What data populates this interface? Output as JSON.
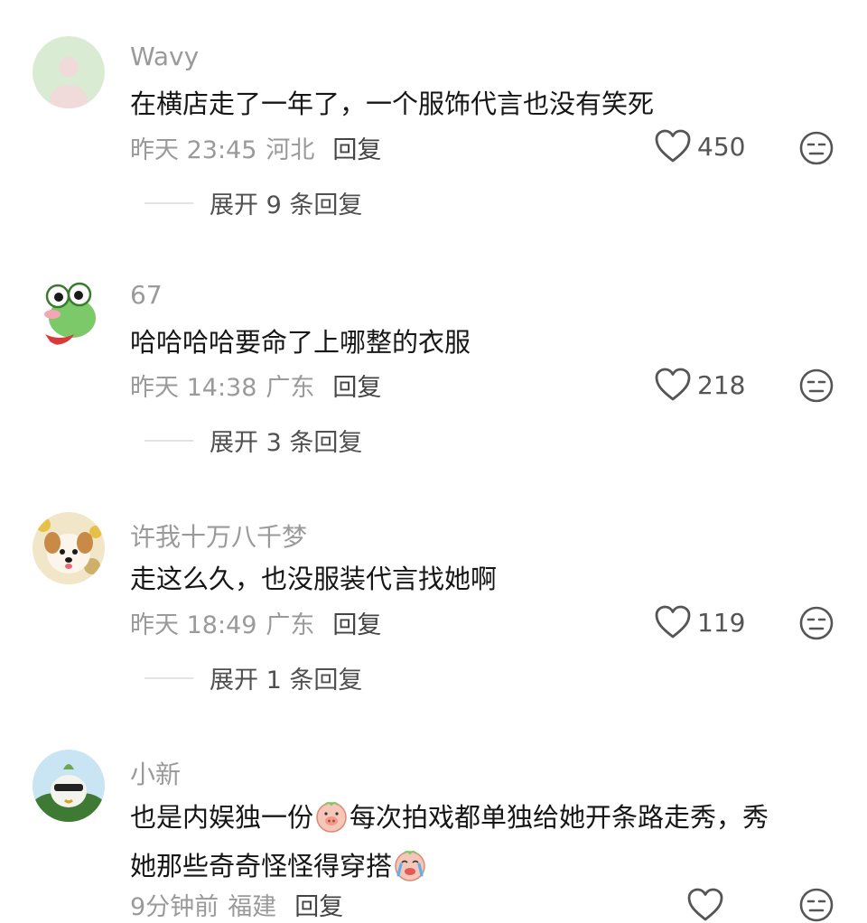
{
  "comments": [
    {
      "username": "Wavy",
      "lines": [
        "在横店走了一年了，一个服饰代言也没有笑死"
      ],
      "time": "昨天 23:45",
      "location": "河北",
      "reply_label": "回复",
      "likes": "450",
      "expand": "展开 9 条回复"
    },
    {
      "username": "67",
      "lines": [
        "哈哈哈哈要命了上哪整的衣服"
      ],
      "time": "昨天 14:38",
      "location": "广东",
      "reply_label": "回复",
      "likes": "218",
      "expand": "展开 3 条回复"
    },
    {
      "username": "许我十万八千梦",
      "lines": [
        "走这么久，也没服装代言找她啊"
      ],
      "time": "昨天 18:49",
      "location": "广东",
      "reply_label": "回复",
      "likes": "119",
      "expand": "展开 1 条回复"
    },
    {
      "username": "小新",
      "line1_a": "也是内娱独一份",
      "line1_b": "每次拍戏都单独给她开条路走秀，秀",
      "line2": "她那些奇奇怪怪得穿搭",
      "time": "9分钟前",
      "location": "福建",
      "reply_label": "回复",
      "emojis": [
        "pig-emoji",
        "crying-pig-emoji"
      ]
    }
  ],
  "icons": {
    "like": "heart-outline-icon",
    "dislike": "neutral-face-icon"
  }
}
